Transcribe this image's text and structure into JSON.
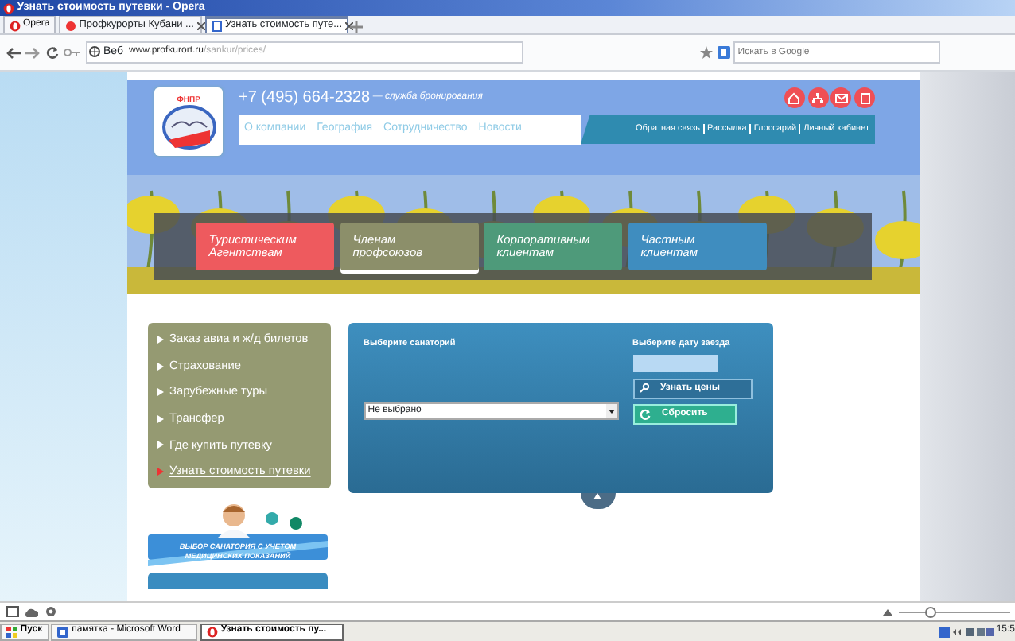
{
  "window": {
    "title": "Узнать стоимость путевки - Opera"
  },
  "browser": {
    "menu_button": "Opera",
    "tabs": [
      {
        "label": "Профкурорты Кубани ...",
        "selected": false
      },
      {
        "label": "Узнать стоимость путе...",
        "selected": true
      }
    ],
    "web_badge": "Веб",
    "url_host": "www.profkurort.ru",
    "url_path": "/sankur/prices/",
    "search_placeholder": "Искать в Google"
  },
  "site": {
    "logo_text": "ФНПР",
    "phone": "+7 (495) 664-2328",
    "phone_note": "— служба бронирования",
    "main_nav": [
      "О компании",
      "География",
      "Сотрудничество",
      "Новости"
    ],
    "secondary_nav": [
      "Обратная связь",
      "Рассылка",
      "Глоссарий",
      "Личный кабинет"
    ],
    "categories": [
      {
        "label": "Туристическим Агентствам",
        "color": "#ee5a5e",
        "selected": false
      },
      {
        "label": "Членам профсоюзов",
        "color": "#8c8f6a",
        "selected": true
      },
      {
        "label": "Корпоративным клиентам",
        "color": "#4e9a7a",
        "selected": false
      },
      {
        "label": "Частным клиентам",
        "color": "#3f8dbf",
        "selected": false
      }
    ],
    "side_menu": [
      {
        "label": "Заказ авиа и ж/д билетов",
        "selected": false
      },
      {
        "label": "Страхование",
        "selected": false
      },
      {
        "label": "Зарубежные туры",
        "selected": false
      },
      {
        "label": "Трансфер",
        "selected": false
      },
      {
        "label": "Где купить путевку",
        "selected": false
      },
      {
        "label": "Узнать стоимость путевки",
        "selected": true
      }
    ],
    "form": {
      "sanatorium_label": "Выберите санаторий",
      "sanatorium_value": "Не выбрано",
      "date_label": "Выберите дату заезда",
      "search_button": "Узнать цены",
      "reset_button": "Сбросить"
    },
    "banner": {
      "text": "ВЫБОР САНАТОРИЯ С УЧЕТОМ МЕДИЦИНСКИХ ПОКАЗАНИЙ"
    }
  },
  "taskbar": {
    "start": "Пуск",
    "items": [
      {
        "label": "памятка - Microsoft Word",
        "selected": false
      },
      {
        "label": "Узнать стоимость пу...",
        "selected": true
      }
    ],
    "clock": "15:5"
  }
}
